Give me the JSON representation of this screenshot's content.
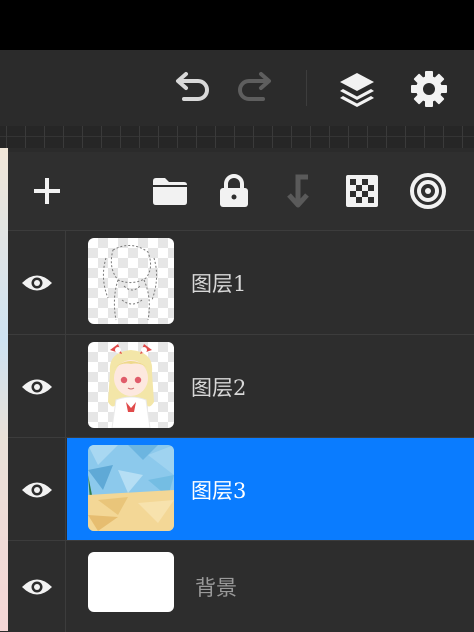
{
  "toolbar": {
    "undo_icon": "undo-icon",
    "redo_icon": "redo-icon",
    "layers_icon": "layers-icon",
    "settings_icon": "gear-icon"
  },
  "layer_panel": {
    "actions": [
      {
        "name": "add-layer-button",
        "icon": "plus-icon"
      },
      {
        "name": "new-folder-button",
        "icon": "folder-icon"
      },
      {
        "name": "lock-layer-button",
        "icon": "lock-icon"
      },
      {
        "name": "merge-down-button",
        "icon": "merge-down-icon"
      },
      {
        "name": "alpha-lock-button",
        "icon": "checker-icon"
      },
      {
        "name": "clipping-button",
        "icon": "target-icon"
      }
    ],
    "layers": [
      {
        "name": "图层1",
        "visible": true,
        "selected": false
      },
      {
        "name": "图层2",
        "visible": true,
        "selected": false
      },
      {
        "name": "图层3",
        "visible": true,
        "selected": true
      },
      {
        "name": "背景",
        "visible": true,
        "selected": false
      }
    ]
  },
  "colors": {
    "accent": "#0a7cff",
    "panel": "#2d2d2d",
    "icon": "#e6e6e6",
    "icon_dim": "#6a6a6a"
  }
}
